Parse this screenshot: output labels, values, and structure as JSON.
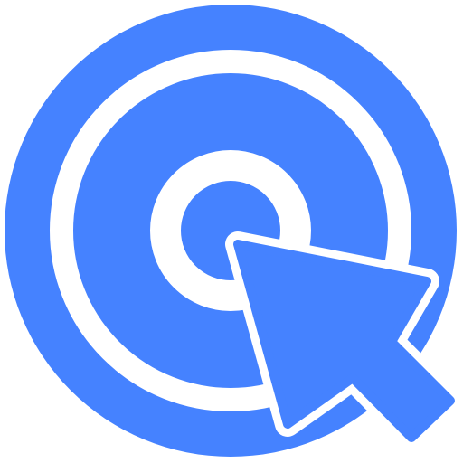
{
  "icon": {
    "name": "target-click-icon",
    "color": "#4582ff",
    "background": "#ffffff"
  }
}
